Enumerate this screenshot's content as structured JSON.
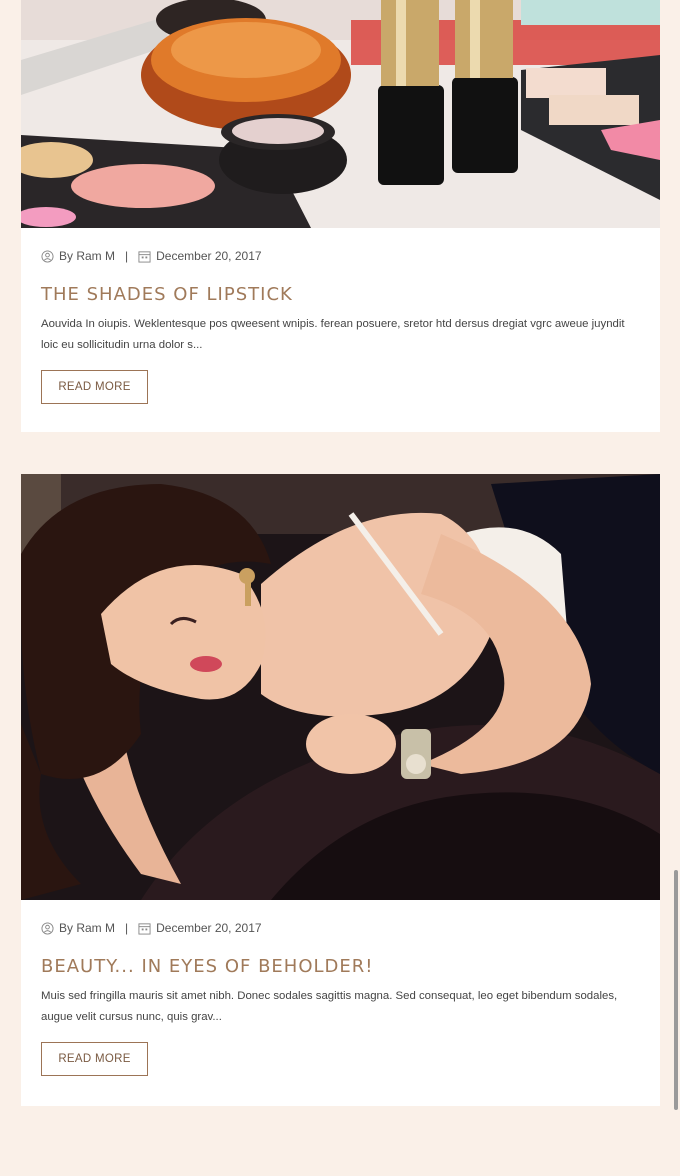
{
  "posts": [
    {
      "author": "By Ram M",
      "date": "December 20, 2017",
      "title": "The Shades of Lipstick",
      "excerpt": "Aouvida In oiupis. Weklentesque pos qweesent wnipis. ferean posuere, sretor htd dersus dregiat vgrc aweue juyndit loic eu sollicitudin urna dolor s...",
      "read_more": "Read More",
      "image": "makeup-products-photo"
    },
    {
      "author": "By Ram M",
      "date": "December 20, 2017",
      "title": "Beauty... In Eyes of Beholder!",
      "excerpt": "Muis sed fringilla mauris sit amet nibh. Donec sodales sagittis magna. Sed consequat, leo eget bibendum sodales, augue velit cursus nunc, quis grav...",
      "read_more": "Read More",
      "image": "woman-reclining-photo"
    }
  ],
  "icons": {
    "author": "user-icon",
    "date": "calendar-icon"
  },
  "colors": {
    "page_bg": "#faf0e8",
    "title": "#a07a5a",
    "button_border": "#9c7456"
  }
}
